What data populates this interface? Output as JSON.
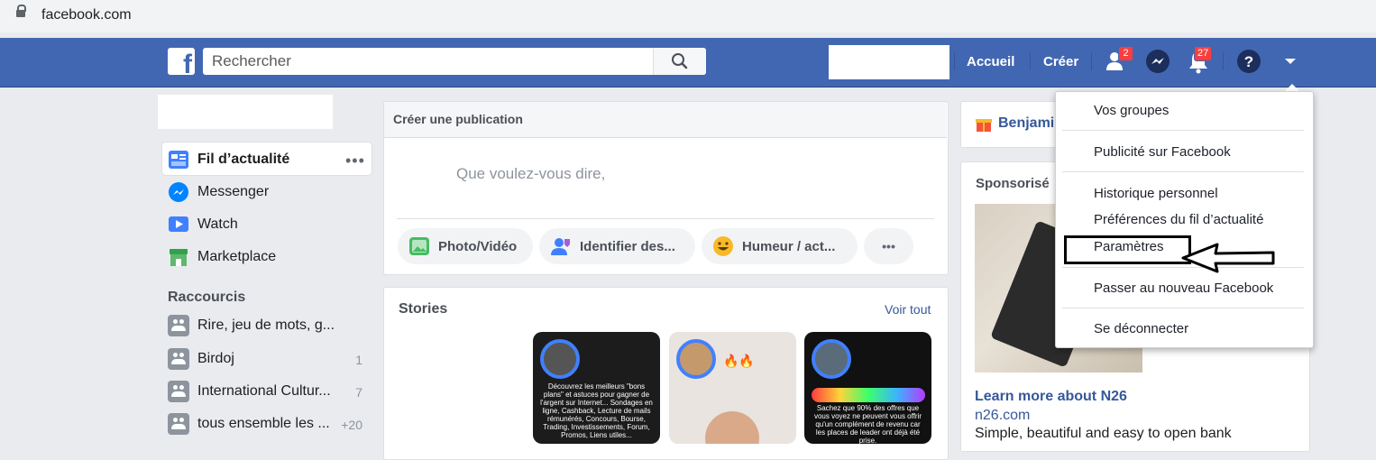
{
  "browser": {
    "url": "facebook.com"
  },
  "header": {
    "search_placeholder": "Rechercher",
    "nav": {
      "home": "Accueil",
      "create": "Créer"
    },
    "badges": {
      "friends": "2",
      "notifications": "27"
    }
  },
  "sidebar": {
    "items": [
      {
        "label": "Fil d’actualité"
      },
      {
        "label": "Messenger"
      },
      {
        "label": "Watch"
      },
      {
        "label": "Marketplace"
      }
    ],
    "shortcuts_title": "Raccourcis",
    "shortcuts": [
      {
        "label": "Rire, jeu de mots, g...",
        "count": ""
      },
      {
        "label": "Birdoj",
        "count": "1"
      },
      {
        "label": "International Cultur...",
        "count": "7"
      },
      {
        "label": "tous ensemble les ...",
        "count": "+20"
      }
    ]
  },
  "composer": {
    "title": "Créer une publication",
    "placeholder": "Que voulez-vous dire,",
    "actions": [
      {
        "label": "Photo/Vidéo"
      },
      {
        "label": "Identifier des..."
      },
      {
        "label": "Humeur / act..."
      }
    ],
    "more": "•••"
  },
  "stories": {
    "title": "Stories",
    "see_all": "Voir tout",
    "cards": [
      {
        "text": "Découvrez les meilleurs \"bons plans\" et astuces pour gagner de l'argent sur Internet... Sondages en ligne, Cashback, Lecture de mails rémunérés, Concours, Bourse, Trading, Investissements, Forum, Promos, Liens utiles..."
      },
      {
        "text": "🔥🔥"
      },
      {
        "text": "Sachez que 90% des offres que vous voyez ne peuvent vous offrir qu'un complément de revenu car les places de leader ont déjà été prise."
      }
    ]
  },
  "right": {
    "birthday": "Benjami",
    "sponsored": "Sponsorisé",
    "ad": {
      "title": "Learn more about N26",
      "domain": "n26.com",
      "description": "Simple, beautiful and easy to open bank"
    }
  },
  "menu": {
    "items": [
      "Vos groupes",
      "Publicité sur Facebook",
      "Historique personnel",
      "Préférences du fil d’actualité",
      "Paramètres",
      "Passer au nouveau Facebook",
      "Se déconnecter"
    ]
  },
  "colors": {
    "brand": "#4267b2",
    "badge": "#fa3e3e",
    "link": "#365899"
  }
}
